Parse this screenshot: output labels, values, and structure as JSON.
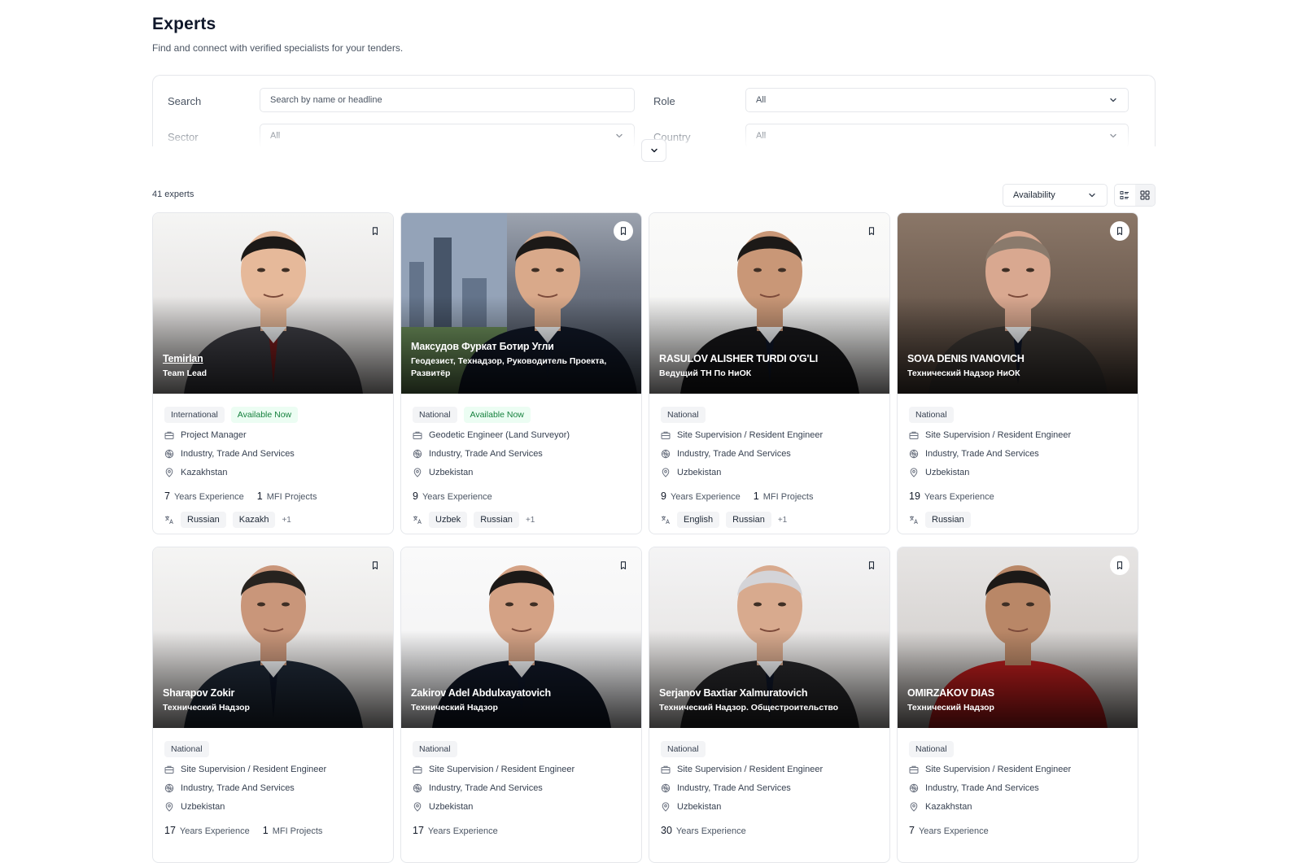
{
  "page": {
    "title": "Experts",
    "subtitle": "Find and connect with verified specialists for your tenders."
  },
  "filters": {
    "search_label": "Search",
    "search_placeholder": "Search by name or headline",
    "role_label": "Role",
    "role_value": "All",
    "sector_label": "Sector",
    "sector_value": "All",
    "country_label": "Country",
    "country_value": "All"
  },
  "results": {
    "count": "41 experts",
    "sort_value": "Availability"
  },
  "icons": {
    "bookmark": "bookmark-icon",
    "briefcase": "briefcase-icon",
    "sector": "globe-icon",
    "location": "map-pin-icon",
    "language": "translate-icon",
    "list_view": "list-view-icon",
    "grid_view": "grid-view-icon"
  },
  "colors": {
    "available_badge_bg": "#ecfdf3",
    "available_badge_text": "#15803d"
  },
  "experts": [
    {
      "name": "Temirlan",
      "headline": "Team Lead",
      "badges": [
        "International"
      ],
      "availability": "Available Now",
      "role": "Project Manager",
      "sector": "Industry, Trade And Services",
      "country": "Kazakhstan",
      "years": "7",
      "years_label": "Years Experience",
      "mfi": "1",
      "mfi_label": "MFI Projects",
      "languages": [
        "Russian",
        "Kazakh"
      ],
      "more_langs": "+1"
    },
    {
      "name": "Максудов Фуркат Ботир Угли",
      "headline": "Геодезист, Технадзор, Руководитель Проекта, Развитёр",
      "badges": [
        "National"
      ],
      "availability": "Available Now",
      "role": "Geodetic Engineer (Land Surveyor)",
      "sector": "Industry, Trade And Services",
      "country": "Uzbekistan",
      "years": "9",
      "years_label": "Years Experience",
      "mfi": "",
      "mfi_label": "",
      "languages": [
        "Uzbek",
        "Russian"
      ],
      "more_langs": "+1"
    },
    {
      "name": "RASULOV ALISHER TURDI O'G'LI",
      "headline": "Ведущий ТН По НиОК",
      "badges": [
        "National"
      ],
      "availability": "",
      "role": "Site Supervision / Resident Engineer",
      "sector": "Industry, Trade And Services",
      "country": "Uzbekistan",
      "years": "9",
      "years_label": "Years Experience",
      "mfi": "1",
      "mfi_label": "MFI Projects",
      "languages": [
        "English",
        "Russian"
      ],
      "more_langs": "+1"
    },
    {
      "name": "SOVA DENIS IVANOVICH",
      "headline": "Технический Надзор НиОК",
      "badges": [
        "National"
      ],
      "availability": "",
      "role": "Site Supervision / Resident Engineer",
      "sector": "Industry, Trade And Services",
      "country": "Uzbekistan",
      "years": "19",
      "years_label": "Years Experience",
      "mfi": "",
      "mfi_label": "",
      "languages": [
        "Russian"
      ],
      "more_langs": ""
    },
    {
      "name": "Sharapov Zokir",
      "headline": "Технический Надзор",
      "badges": [
        "National"
      ],
      "availability": "",
      "role": "Site Supervision / Resident Engineer",
      "sector": "Industry, Trade And Services",
      "country": "Uzbekistan",
      "years": "17",
      "years_label": "Years Experience",
      "mfi": "1",
      "mfi_label": "MFI Projects",
      "languages": [],
      "more_langs": ""
    },
    {
      "name": "Zakirov Adel Abdulxayatovich",
      "headline": "Технический Надзор",
      "badges": [
        "National"
      ],
      "availability": "",
      "role": "Site Supervision / Resident Engineer",
      "sector": "Industry, Trade And Services",
      "country": "Uzbekistan",
      "years": "17",
      "years_label": "Years Experience",
      "mfi": "",
      "mfi_label": "",
      "languages": [],
      "more_langs": ""
    },
    {
      "name": "Serjanov Baxtiar Xalmuratovich",
      "headline": "Технический Надзор. Общестроительство",
      "badges": [
        "National"
      ],
      "availability": "",
      "role": "Site Supervision / Resident Engineer",
      "sector": "Industry, Trade And Services",
      "country": "Uzbekistan",
      "years": "30",
      "years_label": "Years Experience",
      "mfi": "",
      "mfi_label": "",
      "languages": [],
      "more_langs": ""
    },
    {
      "name": "OMIRZAKOV DIAS",
      "headline": "Технический Надзор",
      "badges": [
        "National"
      ],
      "availability": "",
      "role": "Site Supervision / Resident Engineer",
      "sector": "Industry, Trade And Services",
      "country": "Kazakhstan",
      "years": "7",
      "years_label": "Years Experience",
      "mfi": "",
      "mfi_label": "",
      "languages": [],
      "more_langs": ""
    }
  ]
}
